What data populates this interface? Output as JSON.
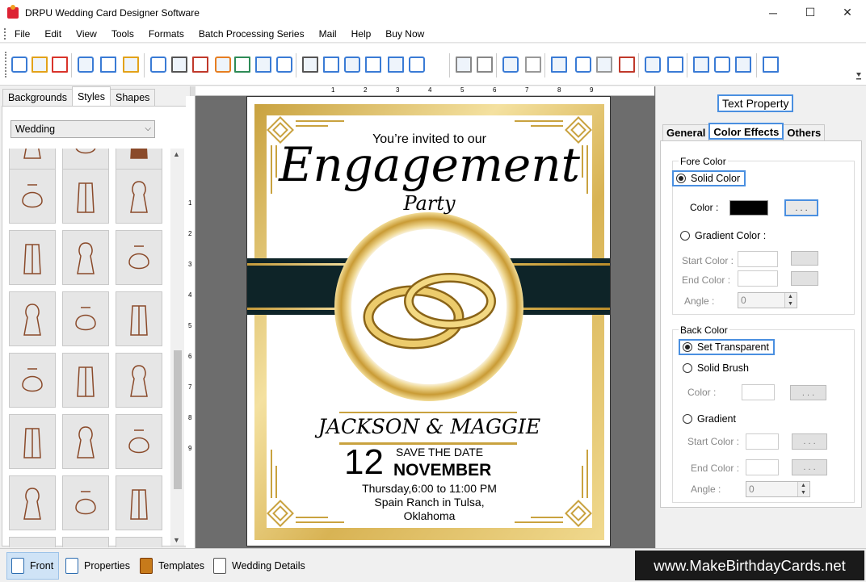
{
  "window": {
    "title": "DRPU Wedding Card Designer Software",
    "controls": {
      "minimize": "─",
      "maximize": "☐",
      "close": "✕"
    }
  },
  "menu": [
    "File",
    "Edit",
    "View",
    "Tools",
    "Formats",
    "Batch Processing Series",
    "Mail",
    "Help",
    "Buy Now"
  ],
  "toolbar_icons": [
    "new-file-icon",
    "open-folder-icon",
    "close-icon",
    "save-icon",
    "save-as-icon",
    "export-icon",
    "properties-icon",
    "print-icon",
    "layers-icon",
    "gift-icon",
    "insert-image-icon",
    "pen-icon",
    "shape-icon",
    "barcode-icon",
    "text-icon",
    "wordart-icon",
    "signature-icon",
    "mail-icon",
    "line-icon",
    "database-icon",
    "database2-icon",
    "undo-icon",
    "redo-icon",
    "cut-icon",
    "copy-icon",
    "paste-icon",
    "delete-icon",
    "bring-front-icon",
    "send-back-icon",
    "grid-icon",
    "actual-size-icon",
    "fit-icon",
    "zoom-icon"
  ],
  "left_panel": {
    "tabs": [
      "Backgrounds",
      "Styles",
      "Shapes"
    ],
    "active_tab": "Styles",
    "category": "Wedding"
  },
  "ruler": {
    "top": [
      "1",
      "2",
      "3",
      "4",
      "5",
      "6",
      "7",
      "8",
      "9"
    ],
    "left": [
      "1",
      "2",
      "3",
      "4",
      "5",
      "6",
      "7",
      "8",
      "9"
    ]
  },
  "card": {
    "invite_line": "You’re invited to our",
    "headline": "Engagement",
    "subheadline": "Party",
    "names": "JACKSON & MAGGIE",
    "save_the_date": "SAVE THE DATE",
    "day": "12",
    "month": "NOVEMBER",
    "time": "Thursday,6:00 to 11:00 PM",
    "venue_line1": "Spain Ranch in Tulsa,",
    "venue_line2": "Oklahoma",
    "colors": {
      "gold": "#d9b24a",
      "band": "#0e2428"
    }
  },
  "right_panel": {
    "header": "Text Property",
    "tabs": [
      "General",
      "Color Effects",
      "Others"
    ],
    "active_tab": "Color Effects",
    "fore_color": {
      "label": "Fore Color",
      "solid_label": "Solid Color",
      "color_label": "Color :",
      "color_value": "#000000",
      "dots": ". . .",
      "gradient_label": "Gradient Color :",
      "start_label": "Start Color :",
      "end_label": "End Color :",
      "angle_label": "Angle :",
      "angle_value": "0"
    },
    "back_color": {
      "label": "Back Color",
      "transparent_label": "Set Transparent",
      "solid_brush_label": "Solid Brush",
      "color_label": "Color :",
      "dots": ". . .",
      "gradient_label": "Gradient",
      "start_label": "Start Color :",
      "end_label": "End Color :",
      "angle_label": "Angle :",
      "angle_value": "0"
    }
  },
  "bottom_tabs": [
    "Front",
    "Properties",
    "Templates",
    "Wedding Details"
  ],
  "active_bottom_tab": "Front",
  "watermark": "www.MakeBirthdayCards.net"
}
